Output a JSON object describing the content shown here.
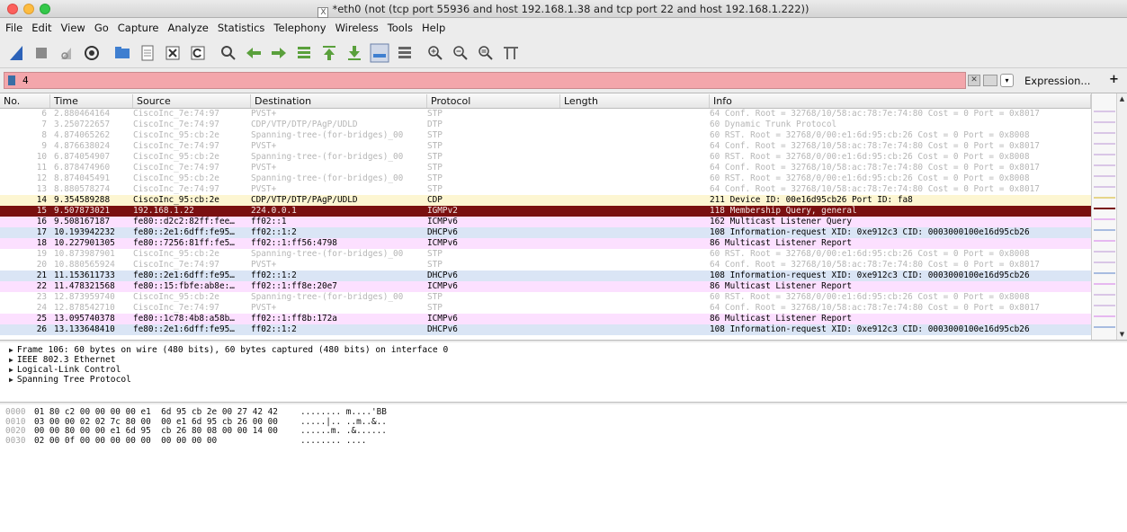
{
  "window": {
    "title": "*eth0 (not (tcp port 55936 and host 192.168.1.38 and tcp port 22 and host 192.168.1.222))"
  },
  "menu": [
    "File",
    "Edit",
    "View",
    "Go",
    "Capture",
    "Analyze",
    "Statistics",
    "Telephony",
    "Wireless",
    "Tools",
    "Help"
  ],
  "toolbar": {
    "icons": [
      "shark-fin-start-icon",
      "stop-square-icon",
      "restart-fin-icon",
      "capture-options-icon",
      "open-folder-icon",
      "file-icon",
      "close-file-icon",
      "reload-icon",
      "find-icon",
      "back-arrow-icon",
      "forward-arrow-icon",
      "go-to-packet-icon",
      "first-packet-icon",
      "last-packet-icon",
      "auto-scroll-icon",
      "colorize-icon",
      "zoom-in-icon",
      "zoom-out-icon",
      "normal-size-icon",
      "resize-columns-icon"
    ]
  },
  "filter": {
    "value": "4",
    "expression_label": "Expression...",
    "plus_label": "+",
    "background_color": "#f3a6ab"
  },
  "packet_list": {
    "headers": [
      "No.",
      "Time",
      "Source",
      "Destination",
      "Protocol",
      "Length",
      "Info"
    ],
    "rows": [
      {
        "no": "6",
        "time": "2.880464164",
        "src": "CiscoInc_7e:74:97",
        "dst": "PVST+",
        "proto": "STP",
        "len": "",
        "info": "64 Conf. Root = 32768/10/58:ac:78:7e:74:80  Cost = 0  Port = 0x8017",
        "style": "grey"
      },
      {
        "no": "7",
        "time": "3.250722657",
        "src": "CiscoInc_7e:74:97",
        "dst": "CDP/VTP/DTP/PAgP/UDLD",
        "proto": "DTP",
        "len": "",
        "info": "60 Dynamic Trunk Protocol",
        "style": "grey"
      },
      {
        "no": "8",
        "time": "4.874065262",
        "src": "CiscoInc_95:cb:2e",
        "dst": "Spanning-tree-(for-bridges)_00",
        "proto": "STP",
        "len": "",
        "info": "60 RST. Root = 32768/0/00:e1:6d:95:cb:26  Cost = 0  Port = 0x8008",
        "style": "grey"
      },
      {
        "no": "9",
        "time": "4.876638024",
        "src": "CiscoInc_7e:74:97",
        "dst": "PVST+",
        "proto": "STP",
        "len": "",
        "info": "64 Conf. Root = 32768/10/58:ac:78:7e:74:80  Cost = 0  Port = 0x8017",
        "style": "grey"
      },
      {
        "no": "10",
        "time": "6.874054907",
        "src": "CiscoInc_95:cb:2e",
        "dst": "Spanning-tree-(for-bridges)_00",
        "proto": "STP",
        "len": "",
        "info": "60 RST. Root = 32768/0/00:e1:6d:95:cb:26  Cost = 0  Port = 0x8008",
        "style": "grey"
      },
      {
        "no": "11",
        "time": "6.878474960",
        "src": "CiscoInc_7e:74:97",
        "dst": "PVST+",
        "proto": "STP",
        "len": "",
        "info": "64 Conf. Root = 32768/10/58:ac:78:7e:74:80  Cost = 0  Port = 0x8017",
        "style": "grey"
      },
      {
        "no": "12",
        "time": "8.874045491",
        "src": "CiscoInc_95:cb:2e",
        "dst": "Spanning-tree-(for-bridges)_00",
        "proto": "STP",
        "len": "",
        "info": "60 RST. Root = 32768/0/00:e1:6d:95:cb:26  Cost = 0  Port = 0x8008",
        "style": "grey"
      },
      {
        "no": "13",
        "time": "8.880578274",
        "src": "CiscoInc_7e:74:97",
        "dst": "PVST+",
        "proto": "STP",
        "len": "",
        "info": "64 Conf. Root = 32768/10/58:ac:78:7e:74:80  Cost = 0  Port = 0x8017",
        "style": "grey"
      },
      {
        "no": "14",
        "time": "9.354589288",
        "src": "CiscoInc_95:cb:2e",
        "dst": "CDP/VTP/DTP/PAgP/UDLD",
        "proto": "CDP",
        "len": "",
        "info": "211 Device ID: 00e16d95cb26  Port ID: fa8",
        "style": "cdp"
      },
      {
        "no": "15",
        "time": "9.507873021",
        "src": "192.168.1.22",
        "dst": "224.0.0.1",
        "proto": "IGMPv2",
        "len": "",
        "info": "118 Membership Query, general",
        "style": "selected"
      },
      {
        "no": "16",
        "time": "9.508167187",
        "src": "fe80::d2c2:82ff:fee…",
        "dst": "ff02::1",
        "proto": "ICMPv6",
        "len": "",
        "info": "162 Multicast Listener Query",
        "style": "icmpv6"
      },
      {
        "no": "17",
        "time": "10.193942232",
        "src": "fe80::2e1:6dff:fe95…",
        "dst": "ff02::1:2",
        "proto": "DHCPv6",
        "len": "",
        "info": "108 Information-request XID: 0xe912c3 CID: 0003000100e16d95cb26",
        "style": "dhcpv6"
      },
      {
        "no": "18",
        "time": "10.227901305",
        "src": "fe80::7256:81ff:fe5…",
        "dst": "ff02::1:ff56:4798",
        "proto": "ICMPv6",
        "len": "",
        "info": "86 Multicast Listener Report",
        "style": "icmpv6"
      },
      {
        "no": "19",
        "time": "10.873987901",
        "src": "CiscoInc_95:cb:2e",
        "dst": "Spanning-tree-(for-bridges)_00",
        "proto": "STP",
        "len": "",
        "info": "60 RST. Root = 32768/0/00:e1:6d:95:cb:26  Cost = 0  Port = 0x8008",
        "style": "grey"
      },
      {
        "no": "20",
        "time": "10.880565924",
        "src": "CiscoInc_7e:74:97",
        "dst": "PVST+",
        "proto": "STP",
        "len": "",
        "info": "64 Conf. Root = 32768/10/58:ac:78:7e:74:80  Cost = 0  Port = 0x8017",
        "style": "grey"
      },
      {
        "no": "21",
        "time": "11.153611733",
        "src": "fe80::2e1:6dff:fe95…",
        "dst": "ff02::1:2",
        "proto": "DHCPv6",
        "len": "",
        "info": "108 Information-request XID: 0xe912c3 CID: 0003000100e16d95cb26",
        "style": "dhcpv6"
      },
      {
        "no": "22",
        "time": "11.478321568",
        "src": "fe80::15:fbfe:ab8e:…",
        "dst": "ff02::1:ff8e:20e7",
        "proto": "ICMPv6",
        "len": "",
        "info": "86 Multicast Listener Report",
        "style": "icmpv6"
      },
      {
        "no": "23",
        "time": "12.873959740",
        "src": "CiscoInc_95:cb:2e",
        "dst": "Spanning-tree-(for-bridges)_00",
        "proto": "STP",
        "len": "",
        "info": "60 RST. Root = 32768/0/00:e1:6d:95:cb:26  Cost = 0  Port = 0x8008",
        "style": "grey"
      },
      {
        "no": "24",
        "time": "12.878542710",
        "src": "CiscoInc_7e:74:97",
        "dst": "PVST+",
        "proto": "STP",
        "len": "",
        "info": "64 Conf. Root = 32768/10/58:ac:78:7e:74:80  Cost = 0  Port = 0x8017",
        "style": "grey"
      },
      {
        "no": "25",
        "time": "13.095740378",
        "src": "fe80::1c78:4b8:a58b…",
        "dst": "ff02::1:ff8b:172a",
        "proto": "ICMPv6",
        "len": "",
        "info": "86 Multicast Listener Report",
        "style": "icmpv6"
      },
      {
        "no": "26",
        "time": "13.133648410",
        "src": "fe80::2e1:6dff:fe95…",
        "dst": "ff02::1:2",
        "proto": "DHCPv6",
        "len": "",
        "info": "108 Information-request XID: 0xe912c3 CID: 0003000100e16d95cb26",
        "style": "dhcpv6"
      }
    ]
  },
  "details": [
    "Frame 106: 60 bytes on wire (480 bits), 60 bytes captured (480 bits) on interface 0",
    "IEEE 802.3 Ethernet",
    "Logical-Link Control",
    "Spanning Tree Protocol"
  ],
  "bytes": [
    {
      "offset": "0000",
      "hex": "01 80 c2 00 00 00 00 e1  6d 95 cb 2e 00 27 42 42",
      "ascii": "........ m....'BB"
    },
    {
      "offset": "0010",
      "hex": "03 00 00 02 02 7c 80 00  00 e1 6d 95 cb 26 00 00",
      "ascii": ".....|.. ..m..&.."
    },
    {
      "offset": "0020",
      "hex": "00 00 80 00 00 e1 6d 95  cb 26 80 08 00 00 14 00",
      "ascii": "......m. .&......"
    },
    {
      "offset": "0030",
      "hex": "02 00 0f 00 00 00 00 00  00 00 00 00",
      "ascii": "........ ...."
    }
  ],
  "colors": {
    "selected_row": "#7a1010",
    "cdp_row": "#fdf6d2",
    "icmpv6_row": "#fce0ff",
    "dhcpv6_row": "#dae5f5",
    "filter_invalid": "#f3a6ab"
  }
}
